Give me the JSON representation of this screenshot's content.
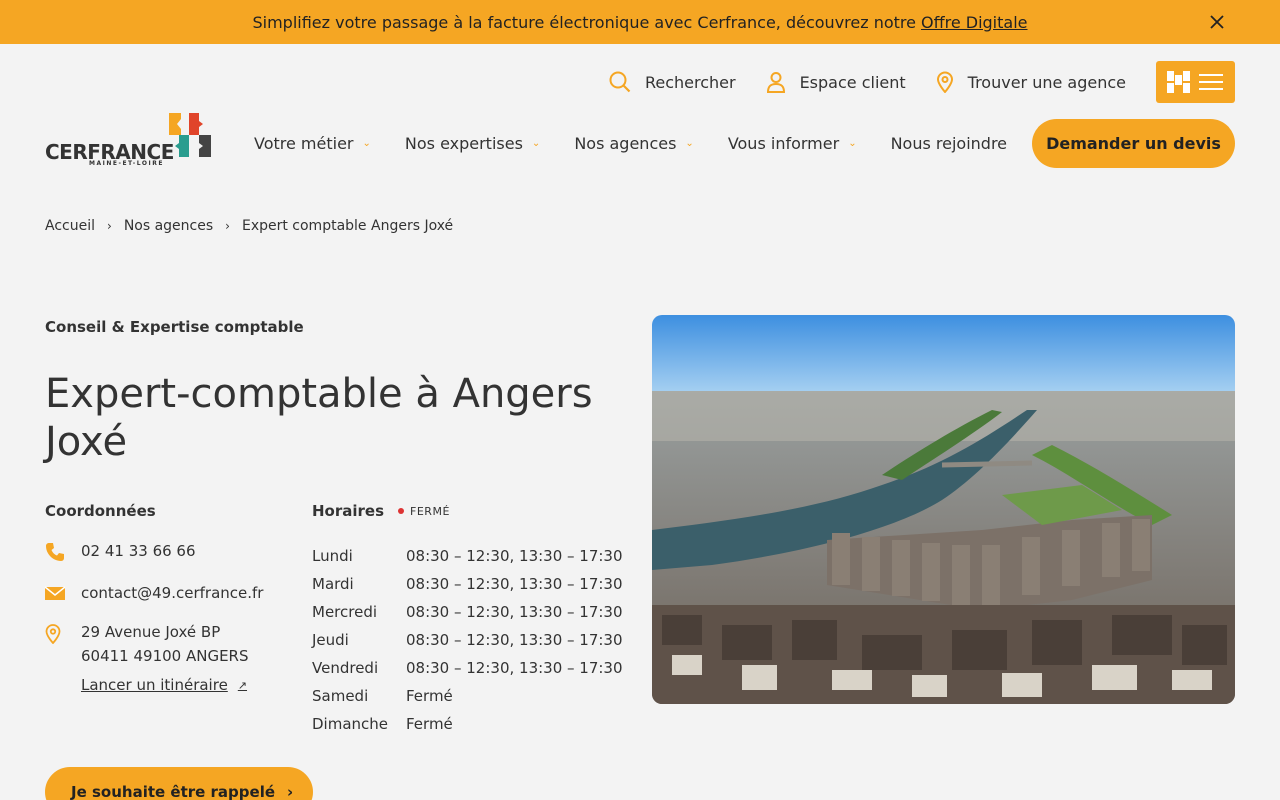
{
  "banner": {
    "text": "Simplifiez votre passage à la facture électronique avec Cerfrance, découvrez notre",
    "link": "Offre Digitale"
  },
  "utility": {
    "search": "Rechercher",
    "client": "Espace client",
    "agency": "Trouver une agence"
  },
  "logo": {
    "name": "CERFRANCE",
    "sub": "MAINE-ET-LOIRE"
  },
  "nav": {
    "items": [
      "Votre métier",
      "Nos expertises",
      "Nos agences",
      "Vous informer",
      "Nous rejoindre"
    ],
    "cta": "Demander un devis"
  },
  "breadcrumb": [
    "Accueil",
    "Nos agences",
    "Expert comptable Angers Joxé"
  ],
  "page": {
    "eyebrow": "Conseil & Expertise comptable",
    "title": "Expert-comptable à Angers Joxé"
  },
  "contact": {
    "heading": "Coordonnées",
    "phone": "02 41 33 66 66",
    "email": "contact@49.cerfrance.fr",
    "address_line1": "29 Avenue Joxé BP",
    "address_line2": "60411 49100 ANGERS",
    "itinerary": "Lancer un itinéraire"
  },
  "hours": {
    "heading": "Horaires",
    "status": "FERMÉ",
    "rows": [
      {
        "day": "Lundi",
        "time": "08:30 – 12:30, 13:30 – 17:30"
      },
      {
        "day": "Mardi",
        "time": "08:30 – 12:30, 13:30 – 17:30"
      },
      {
        "day": "Mercredi",
        "time": "08:30 – 12:30, 13:30 – 17:30"
      },
      {
        "day": "Jeudi",
        "time": "08:30 – 12:30, 13:30 – 17:30"
      },
      {
        "day": "Vendredi",
        "time": "08:30 – 12:30, 13:30 – 17:30"
      },
      {
        "day": "Samedi",
        "time": "Fermé"
      },
      {
        "day": "Dimanche",
        "time": "Fermé"
      }
    ]
  },
  "callback": "Je souhaite être rappelé",
  "colors": {
    "accent": "#f5a623",
    "background": "#f3f3f3",
    "text": "#333333",
    "status_closed": "#dd3333"
  }
}
